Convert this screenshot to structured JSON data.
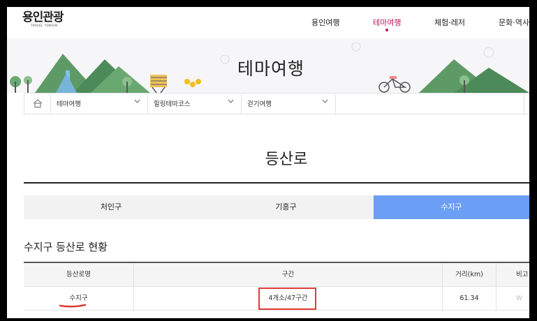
{
  "header": {
    "logo_text": "용인관광",
    "logo_sub": "TRAVEL YONGIN",
    "nav": [
      {
        "label": "용인여행",
        "active": false
      },
      {
        "label": "테마여행",
        "active": true
      },
      {
        "label": "체험·레저",
        "active": false
      },
      {
        "label": "문화·역사",
        "active": false
      }
    ]
  },
  "banner": {
    "title": "테마여행"
  },
  "breadcrumb": {
    "items": [
      {
        "label": "테마여행"
      },
      {
        "label": "힐링테마코스"
      },
      {
        "label": "걷기여행"
      }
    ]
  },
  "page": {
    "title": "등산로"
  },
  "tabs": [
    {
      "label": "처인구",
      "active": false
    },
    {
      "label": "기흥구",
      "active": false
    },
    {
      "label": "수지구",
      "active": true
    }
  ],
  "section": {
    "title": "수지구 등산로 현황"
  },
  "table": {
    "headers": [
      "등산로명",
      "구간",
      "거리(km)",
      "비고"
    ],
    "rows": [
      {
        "name": "수지구",
        "section": "4개소/47구간",
        "distance": "61.34",
        "note": "W"
      }
    ]
  },
  "colors": {
    "accent": "#c2185b",
    "active_tab": "#6b9ef5",
    "highlight": "#e03a3a"
  },
  "icons": {
    "home": "home-icon",
    "caret": "chevron-down-icon"
  }
}
